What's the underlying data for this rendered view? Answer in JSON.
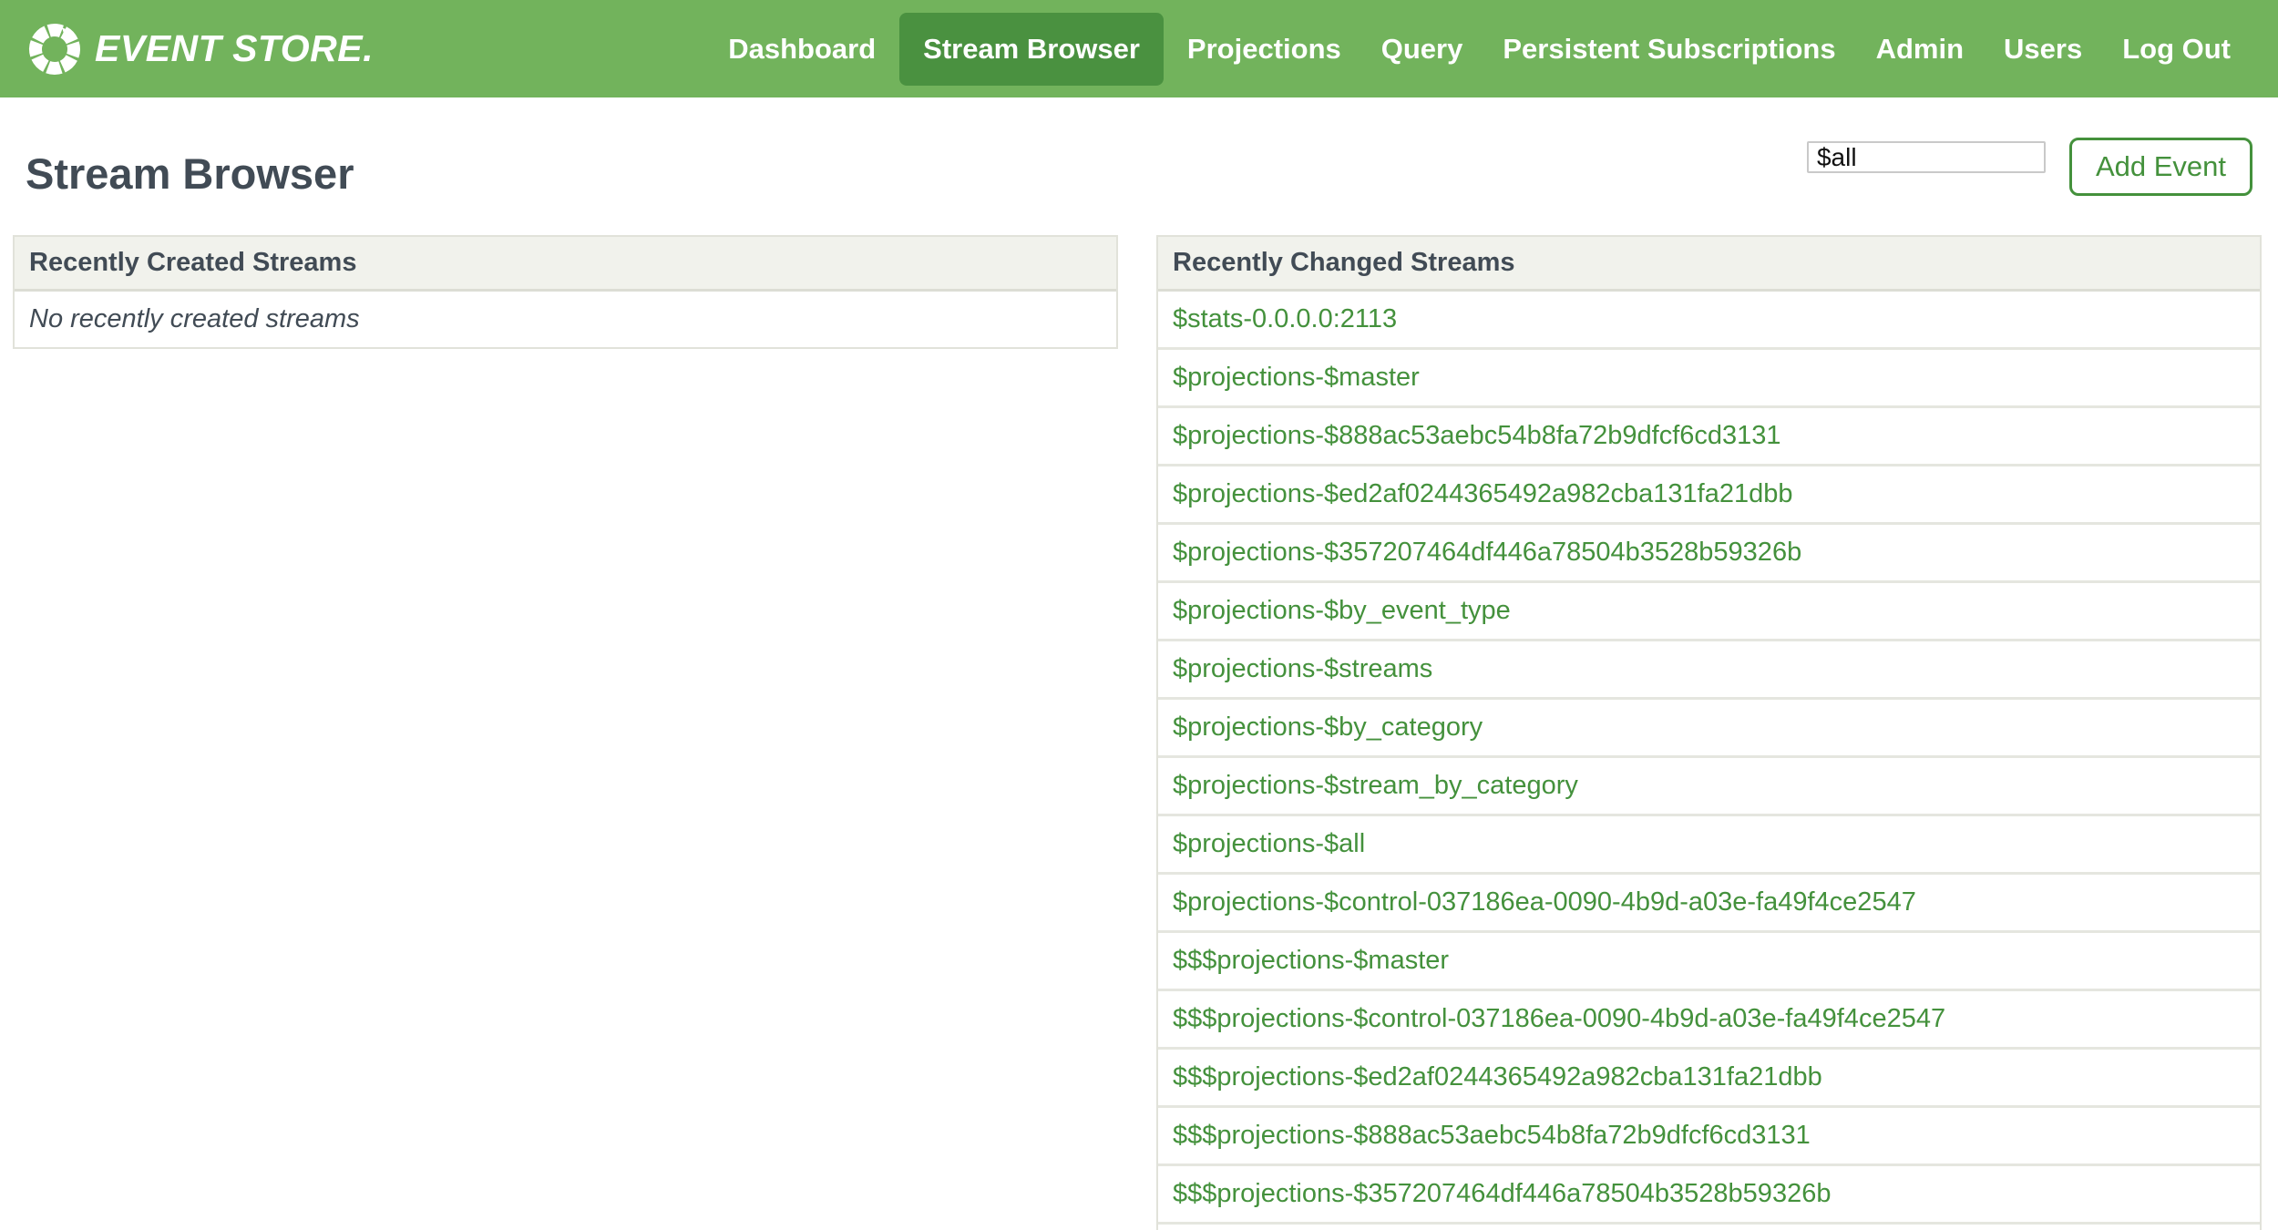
{
  "colors": {
    "header_green": "#72b35c",
    "active_green": "#4a9140",
    "link_green": "#44913c",
    "title_color": "#414b55",
    "panel_header_bg": "#f1f2ec",
    "panel_border": "#e1e2da",
    "row_border": "#e5e6df"
  },
  "navbar": {
    "brand": "EVENT STORE.",
    "items": [
      {
        "label": "Dashboard",
        "active": false
      },
      {
        "label": "Stream Browser",
        "active": true
      },
      {
        "label": "Projections",
        "active": false
      },
      {
        "label": "Query",
        "active": false
      },
      {
        "label": "Persistent Subscriptions",
        "active": false
      },
      {
        "label": "Admin",
        "active": false
      },
      {
        "label": "Users",
        "active": false
      },
      {
        "label": "Log Out",
        "active": false
      }
    ]
  },
  "page": {
    "title": "Stream Browser",
    "stream_input_value": "$all",
    "add_event_label": "Add Event"
  },
  "panels": {
    "created": {
      "title": "Recently Created Streams",
      "empty_message": "No recently created streams"
    },
    "changed": {
      "title": "Recently Changed Streams",
      "streams": [
        "$stats-0.0.0.0:2113",
        "$projections-$master",
        "$projections-$888ac53aebc54b8fa72b9dfcf6cd3131",
        "$projections-$ed2af0244365492a982cba131fa21dbb",
        "$projections-$357207464df446a78504b3528b59326b",
        "$projections-$by_event_type",
        "$projections-$streams",
        "$projections-$by_category",
        "$projections-$stream_by_category",
        "$projections-$all",
        "$projections-$control-037186ea-0090-4b9d-a03e-fa49f4ce2547",
        "$$$projections-$master",
        "$$$projections-$control-037186ea-0090-4b9d-a03e-fa49f4ce2547",
        "$$$projections-$ed2af0244365492a982cba131fa21dbb",
        "$$$projections-$888ac53aebc54b8fa72b9dfcf6cd3131",
        "$$$projections-$357207464df446a78504b3528b59326b"
      ]
    }
  }
}
